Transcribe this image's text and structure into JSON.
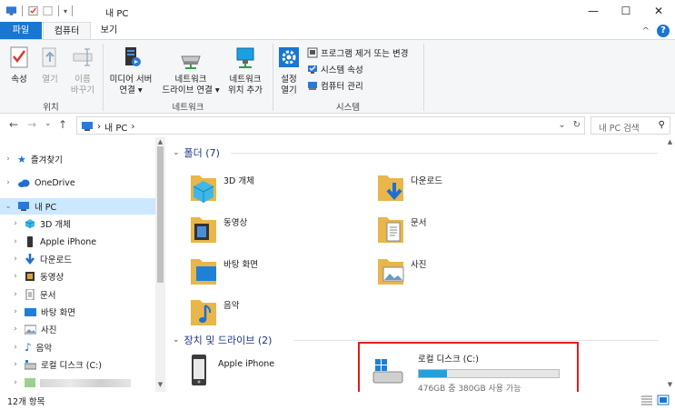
{
  "titlebar": {
    "title": "내 PC",
    "minimize": "—",
    "maximize": "☐",
    "close": "✕"
  },
  "tabs": {
    "file": "파일",
    "computer": "컴퓨터",
    "view": "보기",
    "collapse": "^",
    "help": "?"
  },
  "ribbon": {
    "location": {
      "properties": "속성",
      "open": "열기",
      "rename_line1": "이름",
      "rename_line2": "바꾸기",
      "group": "위치"
    },
    "network": {
      "media_line1": "미디어 서버",
      "media_line2": "연결 ▾",
      "map_line1": "네트워크",
      "map_line2": "드라이브 연결 ▾",
      "add_line1": "네트워크",
      "add_line2": "위치 추가",
      "group": "네트워크"
    },
    "system": {
      "settings_line1": "설정",
      "settings_line2": "열기",
      "uninstall": "프로그램 제거 또는 변경",
      "sysprops": "시스템 속성",
      "manage": "컴퓨터 관리",
      "group": "시스템"
    }
  },
  "address": {
    "back": "←",
    "forward": "→",
    "recent": "⌄",
    "up": "↑",
    "crumb_sep": "›",
    "crumb": "내 PC",
    "crumb_end": "›",
    "dropdown": "⌄",
    "refresh": "↻",
    "search_placeholder": "내 PC 검색",
    "search_icon": "⚲"
  },
  "navpane": {
    "quick_access": "즐겨찾기",
    "onedrive": "OneDrive",
    "this_pc": "내 PC",
    "objects3d": "3D 개체",
    "iphone": "Apple iPhone",
    "downloads": "다운로드",
    "videos": "동영상",
    "documents": "문서",
    "desktop": "바탕 화면",
    "pictures": "사진",
    "music": "음악",
    "local_disk": "로컬 디스크 (C:)"
  },
  "content": {
    "folders_header": "폴더 (7)",
    "folders": {
      "objects3d": "3D 개체",
      "downloads": "다운로드",
      "videos": "동영상",
      "documents": "문서",
      "desktop": "바탕 화면",
      "pictures": "사진",
      "music": "음악"
    },
    "devices_header": "장치 및 드라이브 (2)",
    "iphone": "Apple iPhone",
    "drive": {
      "name": "로컬 디스크 (C:)",
      "free_text": "476GB 중 380GB 사용 가능",
      "used_fraction": 0.2
    }
  },
  "status": {
    "items": "12개 항목"
  },
  "colors": {
    "accent": "#1976d2",
    "folder": "#e8b64a",
    "selection": "#cce8ff",
    "drive_bar": "#26a0da",
    "highlight": "#e01c1c"
  }
}
